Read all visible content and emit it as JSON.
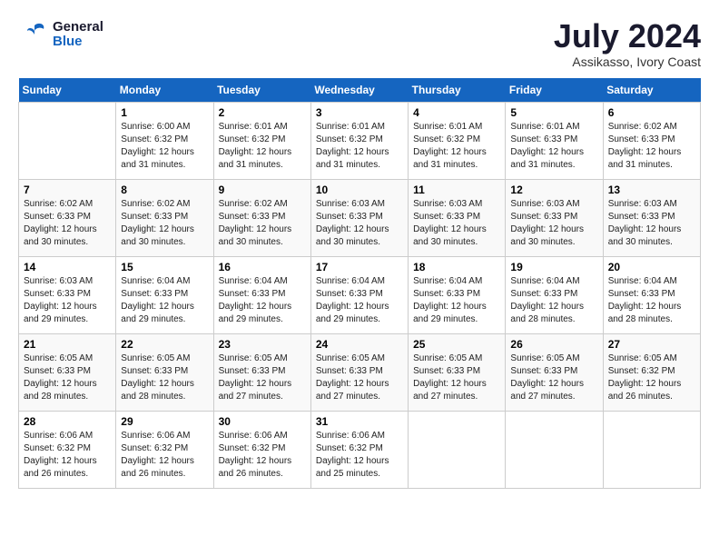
{
  "header": {
    "logo_line1": "General",
    "logo_line2": "Blue",
    "month_year": "July 2024",
    "location": "Assikasso, Ivory Coast"
  },
  "calendar": {
    "days_of_week": [
      "Sunday",
      "Monday",
      "Tuesday",
      "Wednesday",
      "Thursday",
      "Friday",
      "Saturday"
    ],
    "weeks": [
      [
        {
          "day": "",
          "sunrise": "",
          "sunset": "",
          "daylight": ""
        },
        {
          "day": "1",
          "sunrise": "Sunrise: 6:00 AM",
          "sunset": "Sunset: 6:32 PM",
          "daylight": "Daylight: 12 hours and 31 minutes."
        },
        {
          "day": "2",
          "sunrise": "Sunrise: 6:01 AM",
          "sunset": "Sunset: 6:32 PM",
          "daylight": "Daylight: 12 hours and 31 minutes."
        },
        {
          "day": "3",
          "sunrise": "Sunrise: 6:01 AM",
          "sunset": "Sunset: 6:32 PM",
          "daylight": "Daylight: 12 hours and 31 minutes."
        },
        {
          "day": "4",
          "sunrise": "Sunrise: 6:01 AM",
          "sunset": "Sunset: 6:32 PM",
          "daylight": "Daylight: 12 hours and 31 minutes."
        },
        {
          "day": "5",
          "sunrise": "Sunrise: 6:01 AM",
          "sunset": "Sunset: 6:33 PM",
          "daylight": "Daylight: 12 hours and 31 minutes."
        },
        {
          "day": "6",
          "sunrise": "Sunrise: 6:02 AM",
          "sunset": "Sunset: 6:33 PM",
          "daylight": "Daylight: 12 hours and 31 minutes."
        }
      ],
      [
        {
          "day": "7",
          "sunrise": "Sunrise: 6:02 AM",
          "sunset": "Sunset: 6:33 PM",
          "daylight": "Daylight: 12 hours and 30 minutes."
        },
        {
          "day": "8",
          "sunrise": "Sunrise: 6:02 AM",
          "sunset": "Sunset: 6:33 PM",
          "daylight": "Daylight: 12 hours and 30 minutes."
        },
        {
          "day": "9",
          "sunrise": "Sunrise: 6:02 AM",
          "sunset": "Sunset: 6:33 PM",
          "daylight": "Daylight: 12 hours and 30 minutes."
        },
        {
          "day": "10",
          "sunrise": "Sunrise: 6:03 AM",
          "sunset": "Sunset: 6:33 PM",
          "daylight": "Daylight: 12 hours and 30 minutes."
        },
        {
          "day": "11",
          "sunrise": "Sunrise: 6:03 AM",
          "sunset": "Sunset: 6:33 PM",
          "daylight": "Daylight: 12 hours and 30 minutes."
        },
        {
          "day": "12",
          "sunrise": "Sunrise: 6:03 AM",
          "sunset": "Sunset: 6:33 PM",
          "daylight": "Daylight: 12 hours and 30 minutes."
        },
        {
          "day": "13",
          "sunrise": "Sunrise: 6:03 AM",
          "sunset": "Sunset: 6:33 PM",
          "daylight": "Daylight: 12 hours and 30 minutes."
        }
      ],
      [
        {
          "day": "14",
          "sunrise": "Sunrise: 6:03 AM",
          "sunset": "Sunset: 6:33 PM",
          "daylight": "Daylight: 12 hours and 29 minutes."
        },
        {
          "day": "15",
          "sunrise": "Sunrise: 6:04 AM",
          "sunset": "Sunset: 6:33 PM",
          "daylight": "Daylight: 12 hours and 29 minutes."
        },
        {
          "day": "16",
          "sunrise": "Sunrise: 6:04 AM",
          "sunset": "Sunset: 6:33 PM",
          "daylight": "Daylight: 12 hours and 29 minutes."
        },
        {
          "day": "17",
          "sunrise": "Sunrise: 6:04 AM",
          "sunset": "Sunset: 6:33 PM",
          "daylight": "Daylight: 12 hours and 29 minutes."
        },
        {
          "day": "18",
          "sunrise": "Sunrise: 6:04 AM",
          "sunset": "Sunset: 6:33 PM",
          "daylight": "Daylight: 12 hours and 29 minutes."
        },
        {
          "day": "19",
          "sunrise": "Sunrise: 6:04 AM",
          "sunset": "Sunset: 6:33 PM",
          "daylight": "Daylight: 12 hours and 28 minutes."
        },
        {
          "day": "20",
          "sunrise": "Sunrise: 6:04 AM",
          "sunset": "Sunset: 6:33 PM",
          "daylight": "Daylight: 12 hours and 28 minutes."
        }
      ],
      [
        {
          "day": "21",
          "sunrise": "Sunrise: 6:05 AM",
          "sunset": "Sunset: 6:33 PM",
          "daylight": "Daylight: 12 hours and 28 minutes."
        },
        {
          "day": "22",
          "sunrise": "Sunrise: 6:05 AM",
          "sunset": "Sunset: 6:33 PM",
          "daylight": "Daylight: 12 hours and 28 minutes."
        },
        {
          "day": "23",
          "sunrise": "Sunrise: 6:05 AM",
          "sunset": "Sunset: 6:33 PM",
          "daylight": "Daylight: 12 hours and 27 minutes."
        },
        {
          "day": "24",
          "sunrise": "Sunrise: 6:05 AM",
          "sunset": "Sunset: 6:33 PM",
          "daylight": "Daylight: 12 hours and 27 minutes."
        },
        {
          "day": "25",
          "sunrise": "Sunrise: 6:05 AM",
          "sunset": "Sunset: 6:33 PM",
          "daylight": "Daylight: 12 hours and 27 minutes."
        },
        {
          "day": "26",
          "sunrise": "Sunrise: 6:05 AM",
          "sunset": "Sunset: 6:33 PM",
          "daylight": "Daylight: 12 hours and 27 minutes."
        },
        {
          "day": "27",
          "sunrise": "Sunrise: 6:05 AM",
          "sunset": "Sunset: 6:32 PM",
          "daylight": "Daylight: 12 hours and 26 minutes."
        }
      ],
      [
        {
          "day": "28",
          "sunrise": "Sunrise: 6:06 AM",
          "sunset": "Sunset: 6:32 PM",
          "daylight": "Daylight: 12 hours and 26 minutes."
        },
        {
          "day": "29",
          "sunrise": "Sunrise: 6:06 AM",
          "sunset": "Sunset: 6:32 PM",
          "daylight": "Daylight: 12 hours and 26 minutes."
        },
        {
          "day": "30",
          "sunrise": "Sunrise: 6:06 AM",
          "sunset": "Sunset: 6:32 PM",
          "daylight": "Daylight: 12 hours and 26 minutes."
        },
        {
          "day": "31",
          "sunrise": "Sunrise: 6:06 AM",
          "sunset": "Sunset: 6:32 PM",
          "daylight": "Daylight: 12 hours and 25 minutes."
        },
        {
          "day": "",
          "sunrise": "",
          "sunset": "",
          "daylight": ""
        },
        {
          "day": "",
          "sunrise": "",
          "sunset": "",
          "daylight": ""
        },
        {
          "day": "",
          "sunrise": "",
          "sunset": "",
          "daylight": ""
        }
      ]
    ]
  }
}
